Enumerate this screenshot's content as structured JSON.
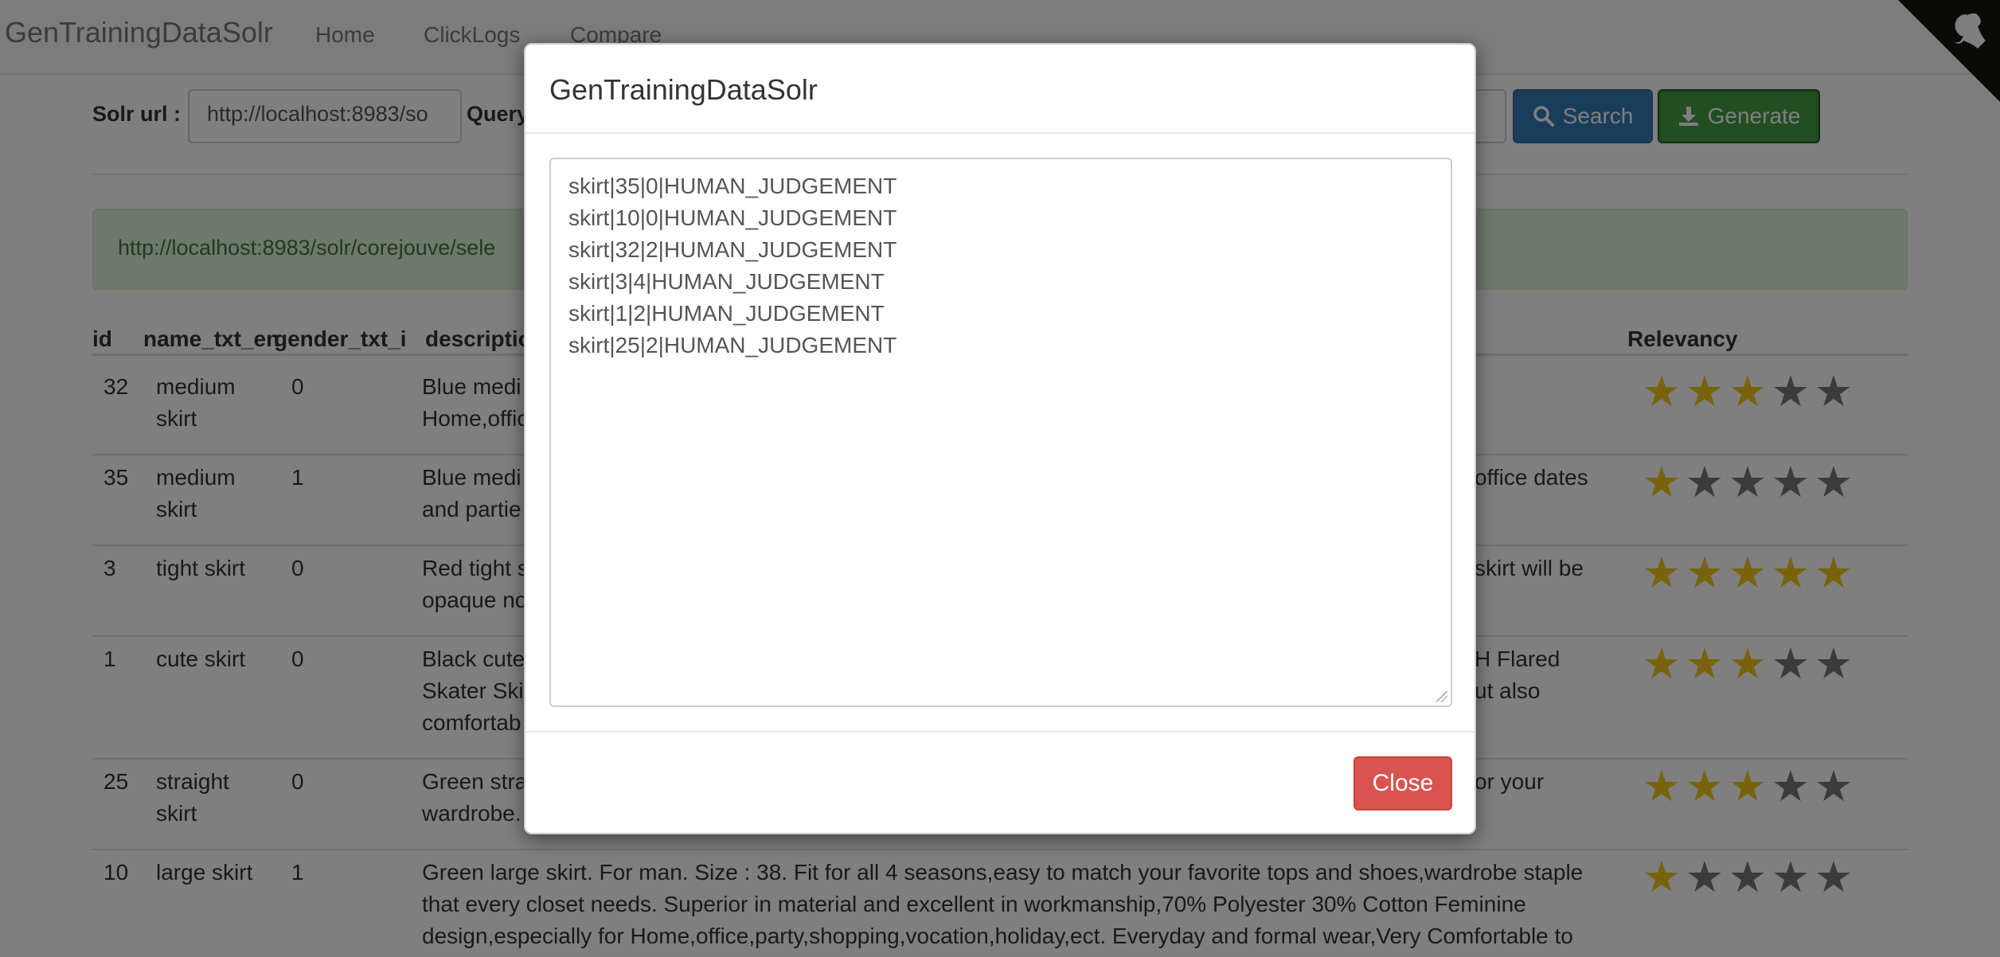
{
  "navbar": {
    "brand": "GenTrainingDataSolr",
    "links": [
      "Home",
      "ClickLogs",
      "Compare"
    ]
  },
  "form": {
    "solr_url_label": "Solr url :",
    "solr_url_value": "http://localhost:8983/so",
    "query_label": "Query",
    "search_label": "Search",
    "generate_label": "Generate"
  },
  "alert": {
    "text": "http://localhost:8983/solr/corejouve/sele"
  },
  "table": {
    "headers": [
      "id",
      "name_txt_en",
      "gender_txt_i",
      "description",
      "Relevancy"
    ],
    "rows": [
      {
        "id": "32",
        "name": [
          "medium",
          "skirt"
        ],
        "gender": "0",
        "desc_left": [
          "Blue medi",
          "Home,offic"
        ],
        "desc_right": [
          "",
          ""
        ],
        "stars": 3
      },
      {
        "id": "35",
        "name": [
          "medium",
          "skirt"
        ],
        "gender": "1",
        "desc_left": [
          "Blue medi",
          "and partie"
        ],
        "desc_right": [
          "office dates",
          ""
        ],
        "stars": 1
      },
      {
        "id": "3",
        "name": [
          "tight skirt"
        ],
        "gender": "0",
        "desc_left": [
          "Red tight s",
          "opaque no"
        ],
        "desc_right": [
          "skirt will be",
          ""
        ],
        "stars": 5
      },
      {
        "id": "1",
        "name": [
          "cute skirt"
        ],
        "gender": "0",
        "desc_left": [
          "Black cute",
          "Skater Ski",
          "comfortab"
        ],
        "desc_right": [
          "H Flared",
          "ut also",
          ""
        ],
        "stars": 3
      },
      {
        "id": "25",
        "name": [
          "straight",
          "skirt"
        ],
        "gender": "0",
        "desc_left": [
          "Green stra",
          "wardrobe."
        ],
        "desc_right": [
          "or your",
          ""
        ],
        "stars": 3
      },
      {
        "id": "10",
        "name": [
          "large skirt"
        ],
        "gender": "1",
        "desc_left": [
          "Green large skirt. For man. Size : 38. Fit for all 4 seasons,easy to match your favorite tops and shoes,wardrobe staple",
          "that every closet needs. Superior in material and excellent in workmanship,70% Polyester 30% Cotton Feminine",
          "design,especially for Home,office,party,shopping,vocation,holiday,ect. Everyday and formal wear,Very Comfortable to"
        ],
        "desc_right": [
          "",
          "",
          ""
        ],
        "stars": 1
      }
    ]
  },
  "modal": {
    "title": "GenTrainingDataSolr",
    "lines": [
      "skirt|35|0|HUMAN_JUDGEMENT",
      "skirt|10|0|HUMAN_JUDGEMENT",
      "skirt|32|2|HUMAN_JUDGEMENT",
      "skirt|3|4|HUMAN_JUDGEMENT",
      "skirt|1|2|HUMAN_JUDGEMENT",
      "skirt|25|2|HUMAN_JUDGEMENT"
    ],
    "close_label": "Close"
  },
  "icons": {
    "search": "search-icon",
    "generate": "download-icon",
    "github": "github-corner-icon",
    "star": "star-icon"
  },
  "colors": {
    "search_button": "#337ab7",
    "generate_button": "#449d44",
    "close_button": "#d9534f",
    "alert_bg": "#dff0d8",
    "star_on": "#f0c419",
    "star_off": "#777777"
  }
}
